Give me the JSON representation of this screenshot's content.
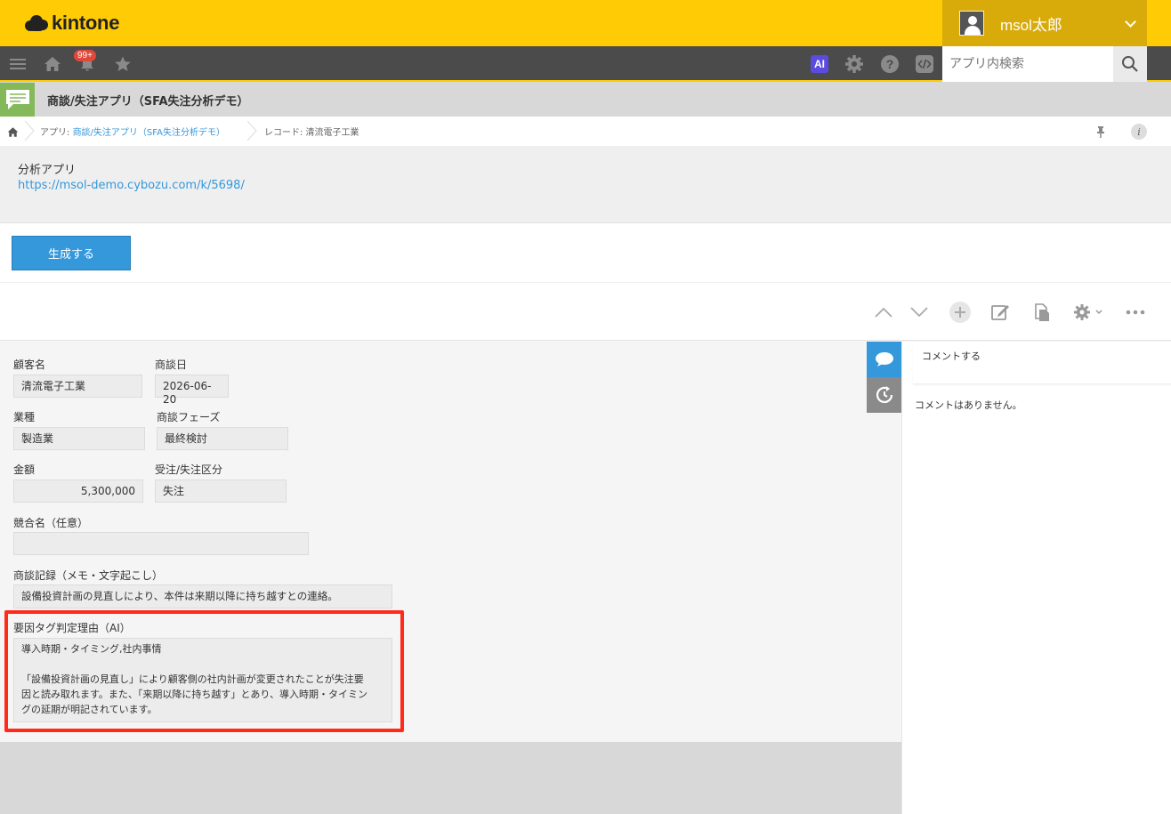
{
  "header": {
    "logo_text": "kintone",
    "user_name": "msol太郎"
  },
  "nav": {
    "notification_badge": "99+",
    "ai_label": "AI",
    "search_placeholder": "アプリ内検索"
  },
  "app": {
    "title": "商談/失注アプリ（SFA失注分析デモ）"
  },
  "breadcrumb": {
    "app_prefix": "アプリ: ",
    "app_link": "商談/失注アプリ（SFA失注分析デモ）",
    "record": "レコード: 清流電子工業",
    "info_label": "i"
  },
  "header_area": {
    "label": "分析アプリ",
    "link": "https://msol-demo.cybozu.com/k/5698/"
  },
  "generate_button": "生成する",
  "form": {
    "customer": {
      "label": "顧客名",
      "value": "清流電子工業"
    },
    "date": {
      "label": "商談日",
      "value": "2026-06-20"
    },
    "industry": {
      "label": "業種",
      "value": "製造業"
    },
    "phase": {
      "label": "商談フェーズ",
      "value": "最終検討"
    },
    "amount": {
      "label": "金額",
      "value": "5,300,000"
    },
    "result": {
      "label": "受注/失注区分",
      "value": "失注"
    },
    "competitor": {
      "label": "競合名（任意）",
      "value": ""
    },
    "notes": {
      "label": "商談記録（メモ・文字起こし）",
      "value": "設備投資計画の見直しにより、本件は来期以降に持ち越すとの連絡。"
    },
    "reason": {
      "label": "要因タグ判定理由（AI）",
      "line1": "導入時期・タイミング,社内事情",
      "line2": "「設備投資計画の見直し」により顧客側の社内計画が変更されたことが失注要",
      "line3": "因と読み取れます。また、「来期以降に持ち越す」とあり、導入時期・タイミン",
      "line4": "グの延期が明記されています。"
    }
  },
  "comments": {
    "input_placeholder": "コメントする",
    "empty_text": "コメントはありません。"
  },
  "colors": {
    "brand_yellow": "#ffcb05",
    "user_box": "#d8ab0b",
    "nav_bg": "#4b4b4b",
    "accent_blue": "#3498db",
    "highlight_red": "#ff2a1a"
  }
}
